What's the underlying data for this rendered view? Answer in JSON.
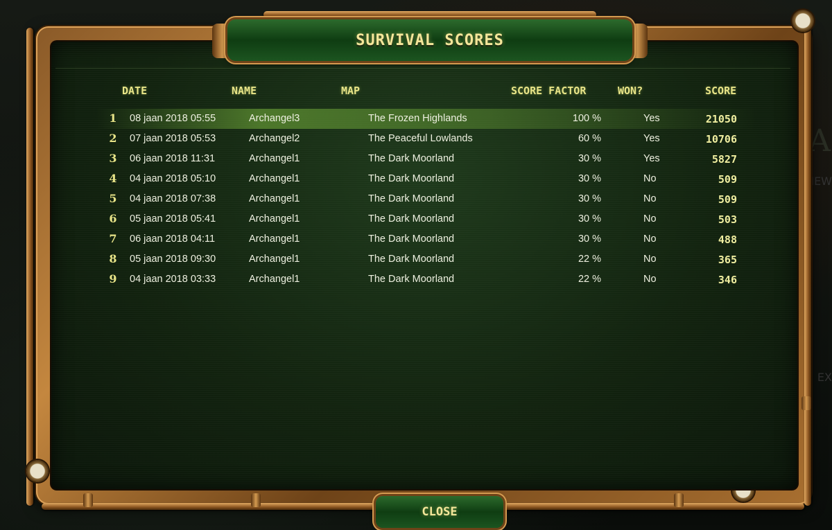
{
  "title": "SURVIVAL SCORES",
  "background_text": {
    "logo": "THEY A",
    "line1": "NEW",
    "line2": "EX"
  },
  "columns": {
    "date": "DATE",
    "name": "NAME",
    "map": "MAP",
    "score_factor": "SCORE FACTOR",
    "won": "WON?",
    "score": "SCORE"
  },
  "rows": [
    {
      "rank": "1",
      "date": "08 jaan 2018 05:55",
      "name": "Archangel3",
      "map": "The Frozen Highlands",
      "factor": "100 %",
      "won": "Yes",
      "score": "21050"
    },
    {
      "rank": "2",
      "date": "07 jaan 2018 05:53",
      "name": "Archangel2",
      "map": "The Peaceful Lowlands",
      "factor": "60 %",
      "won": "Yes",
      "score": "10706"
    },
    {
      "rank": "3",
      "date": "06 jaan 2018 11:31",
      "name": "Archangel1",
      "map": "The Dark Moorland",
      "factor": "30 %",
      "won": "Yes",
      "score": "5827"
    },
    {
      "rank": "4",
      "date": "04 jaan 2018 05:10",
      "name": "Archangel1",
      "map": "The Dark Moorland",
      "factor": "30 %",
      "won": "No",
      "score": "509"
    },
    {
      "rank": "5",
      "date": "04 jaan 2018 07:38",
      "name": "Archangel1",
      "map": "The Dark Moorland",
      "factor": "30 %",
      "won": "No",
      "score": "509"
    },
    {
      "rank": "6",
      "date": "05 jaan 2018 05:41",
      "name": "Archangel1",
      "map": "The Dark Moorland",
      "factor": "30 %",
      "won": "No",
      "score": "503"
    },
    {
      "rank": "7",
      "date": "06 jaan 2018 04:11",
      "name": "Archangel1",
      "map": "The Dark Moorland",
      "factor": "30 %",
      "won": "No",
      "score": "488"
    },
    {
      "rank": "8",
      "date": "05 jaan 2018 09:30",
      "name": "Archangel1",
      "map": "The Dark Moorland",
      "factor": "22 %",
      "won": "No",
      "score": "365"
    },
    {
      "rank": "9",
      "date": "04 jaan 2018 03:33",
      "name": "Archangel1",
      "map": "The Dark Moorland",
      "factor": "22 %",
      "won": "No",
      "score": "346"
    }
  ],
  "close_label": "CLOSE",
  "colors": {
    "accent": "#f4e79a",
    "panel": "#12230f",
    "frame": "#c4873f"
  }
}
